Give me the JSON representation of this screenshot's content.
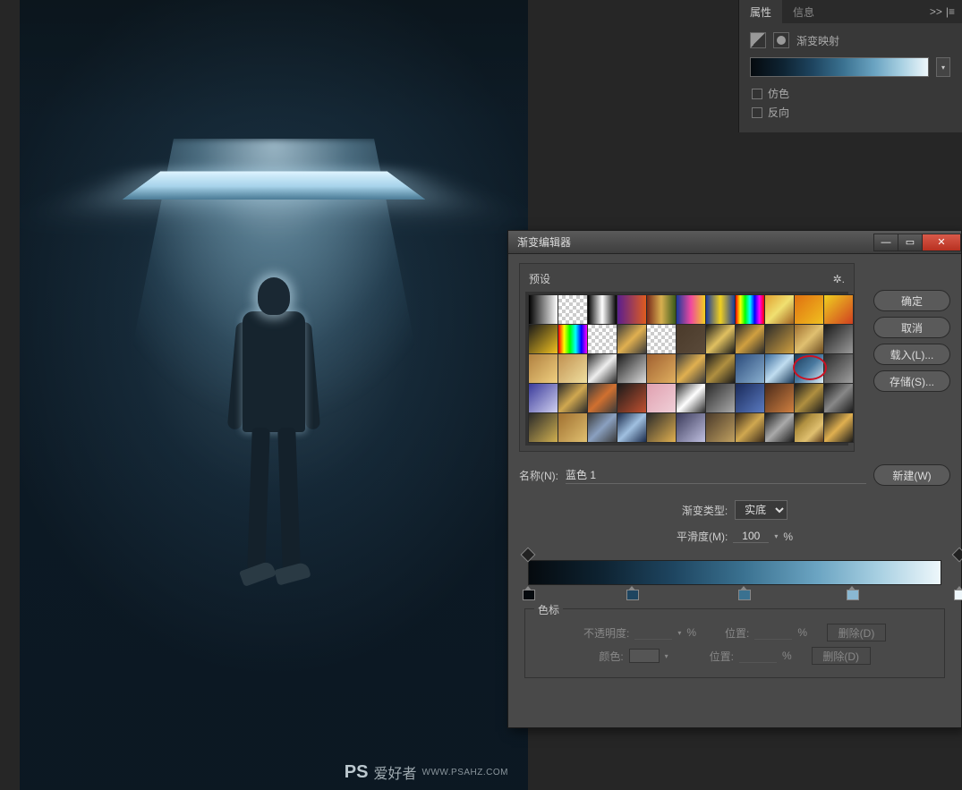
{
  "watermark": {
    "ps": "PS",
    "cn": "爱好者",
    "url": "WWW.PSAHZ.COM"
  },
  "properties_panel": {
    "tab_properties": "属性",
    "tab_info": "信息",
    "menu_glyph": ">>",
    "menu_bars": "|≡",
    "adjustment_label": "渐变映射",
    "dither_label": "仿色",
    "reverse_label": "反向"
  },
  "dialog": {
    "title": "渐变编辑器",
    "btn_ok": "确定",
    "btn_cancel": "取消",
    "btn_load": "载入(L)...",
    "btn_save": "存储(S)...",
    "btn_new": "新建(W)",
    "presets_label": "预设",
    "gear_glyph": "✲.",
    "name_label": "名称(N):",
    "name_value": "蓝色 1",
    "grad_type_label": "渐变类型:",
    "grad_type_value": "实底",
    "smooth_label": "平滑度(M):",
    "smooth_value": "100",
    "percent": "%",
    "stops_label": "色标",
    "opacity_label": "不透明度:",
    "position_label": "位置:",
    "color_label": "颜色:",
    "delete_label": "删除(D)"
  },
  "win_buttons": {
    "min": "—",
    "max": "▭",
    "close": "✕"
  },
  "preset_swatches": [
    "linear-gradient(90deg,#000,#fff)",
    "repeating-conic-gradient(#ccc 0 25%,#fff 0 50%) 0 0/8px 8px, linear-gradient(90deg,#000,transparent)",
    "linear-gradient(90deg,#000,#fff 50%,#000)",
    "linear-gradient(90deg,#5a1e8f,#e05c1f)",
    "linear-gradient(90deg,#7a2a1a,#d8b050,#3a5a1a)",
    "linear-gradient(90deg,#1a3a9a,#f048a0,#f0d020)",
    "linear-gradient(90deg,#1a3a9a,#f0d020,#1a3a9a)",
    "linear-gradient(90deg,#f00,#ff0,#0f0,#0ff,#00f,#f0f,#f00)",
    "linear-gradient(135deg,#e0a030,#f0e070,#a06020)",
    "linear-gradient(135deg,#e07010,#f0c020)",
    "linear-gradient(135deg,#f0d020,#d04020)",
    "linear-gradient(135deg,#1a1a1a,#f0c020)",
    "linear-gradient(90deg,#f00,#ff0,#0f0,#0ff,#00f,#f0f)",
    "repeating-conic-gradient(#ccc 0 25%,#fff 0 50%) 0 0/8px 8px",
    "linear-gradient(135deg,#3a3a3a,#e0b050,#3a3a3a)",
    "repeating-conic-gradient(#ccc 0 25%,#fff 0 50%) 0 0/8px 8px, linear-gradient(135deg,#d8b050,transparent)",
    "linear-gradient(135deg,#4a3a2a,#5a4a3a)",
    "linear-gradient(135deg,#1a1a1a,#e0c060,#1a1a1a)",
    "linear-gradient(135deg,#2a2a2a,#d0a040,#2a2a2a)",
    "linear-gradient(135deg,#2a2a2a,#d0a040)",
    "linear-gradient(135deg,#a07030,#e0c070,#6a4a20)",
    "linear-gradient(135deg,#1a1a1a,#9a9a9a)",
    "linear-gradient(135deg,#b08040,#f0d080)",
    "linear-gradient(135deg,#c09050,#f0e0a0)",
    "linear-gradient(135deg,#2a2a2a,#eee,#2a2a2a)",
    "linear-gradient(135deg,#1a1a1a,#ddd)",
    "linear-gradient(135deg,#a06030,#e0b060)",
    "linear-gradient(135deg,#3a3a3a,#e0b050,#3a3a3a)",
    "linear-gradient(135deg,#1a1a1a,#b09040,#1a1a1a)",
    "linear-gradient(135deg,#2a4a7a,#8ab0d0)",
    "linear-gradient(135deg,#3a6a9a,#c0ddf0,#1a3a5a)",
    "linear-gradient(135deg,#1a3a5a,#4a7aa0,#e0f0f8)",
    "linear-gradient(135deg,#2a2a2a,#a0a0a0)",
    "linear-gradient(135deg,#3a3a9a,#d0d0f0)",
    "linear-gradient(135deg,#2a2a2a,#d0a850,#2a2a2a)",
    "linear-gradient(135deg,#3a3a3a,#d07030,#3a3a3a)",
    "linear-gradient(135deg,#1a1a1a,#c05030)",
    "linear-gradient(135deg,#e0a0b0,#f0d0d8)",
    "linear-gradient(135deg,#2a2a2a,#fff,#2a2a2a)",
    "linear-gradient(135deg,#2a2a2a,#aaa)",
    "linear-gradient(135deg,#1a2a5a,#5a7ac0)",
    "linear-gradient(135deg,#4a2a1a,#d08040)",
    "linear-gradient(135deg,#1a1a1a,#b09040,#1a1a1a)",
    "linear-gradient(135deg,#1a1a1a,#888,#1a1a1a)",
    "linear-gradient(135deg,#2a2a2a,#d0b050)",
    "linear-gradient(135deg,#a07030,#e0c070)",
    "linear-gradient(135deg,#3a3a3a,#8aa0c0,#3a3a3a)",
    "linear-gradient(135deg,#1a2a4a,#a0c0e0,#1a2a4a)",
    "linear-gradient(135deg,#2a2a2a,#e0b050)",
    "linear-gradient(135deg,#3a3a5a,#c0c0e0)",
    "linear-gradient(135deg,#4a3a2a,#c0a060)",
    "linear-gradient(135deg,#3a2a1a,#d0a850,#3a2a1a)",
    "linear-gradient(135deg,#1a1a1a,#aaa,#1a1a1a)",
    "linear-gradient(135deg,#1a1a1a,#b09040,#e0c070,#5a3a1a)",
    "linear-gradient(135deg,#1a1a1a,#e0b050,#1a1a1a)"
  ],
  "circle_mark_index": 31,
  "opacity_stops": [
    0,
    100
  ],
  "color_stops": [
    {
      "pos": 0,
      "color": "#050a0e"
    },
    {
      "pos": 24,
      "color": "#1e4560"
    },
    {
      "pos": 50,
      "color": "#3a7190"
    },
    {
      "pos": 75,
      "color": "#8ab8d2"
    },
    {
      "pos": 100,
      "color": "#eef7fb"
    }
  ]
}
